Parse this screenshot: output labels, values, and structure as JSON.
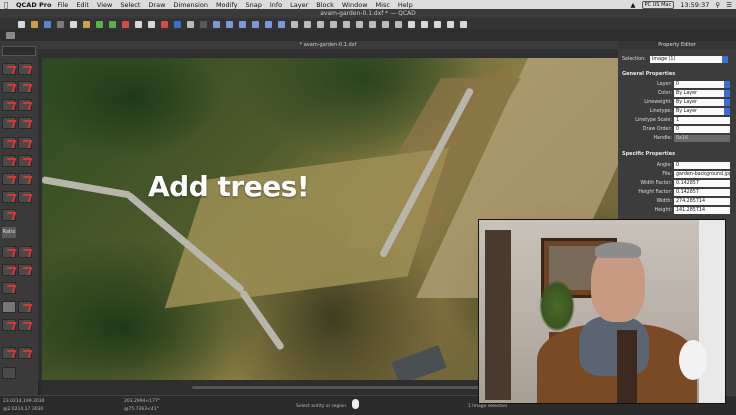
{
  "menubar": {
    "app_name": "QCAD Pro",
    "items": [
      "File",
      "Edit",
      "View",
      "Select",
      "Draw",
      "Dimension",
      "Modify",
      "Snap",
      "Info",
      "Layer",
      "Block",
      "Window",
      "Misc",
      "Help"
    ],
    "keyboard_badge": "PC US Mac",
    "clock": "13:59:37"
  },
  "window": {
    "title": "avam-garden-0.1.dxf * — QCAD",
    "doc_tab": "* avam-garden-0.1.dxf"
  },
  "tool_panel": {
    "tool_label": "Ratio"
  },
  "canvas": {
    "overlay_text": "Add trees!"
  },
  "property_editor": {
    "title": "Property Editor",
    "selection_label": "Selection:",
    "selection_value": "Image (1)",
    "general_heading": "General Properties",
    "specific_heading": "Specific Properties",
    "general": [
      {
        "label": "Layer:",
        "value": "0",
        "dropdown": true
      },
      {
        "label": "Color:",
        "value": "By Layer",
        "dropdown": true
      },
      {
        "label": "Lineweight:",
        "value": "By Layer",
        "dropdown": true
      },
      {
        "label": "Linetype:",
        "value": "By Layer",
        "dropdown": true
      },
      {
        "label": "Linetype Scale:",
        "value": "1",
        "dropdown": false
      },
      {
        "label": "Draw Order:",
        "value": "0",
        "dropdown": false
      },
      {
        "label": "Handle:",
        "value": "0x16",
        "dropdown": false
      }
    ],
    "specific": [
      {
        "label": "Angle:",
        "value": "0"
      },
      {
        "label": "File:",
        "value": "garden-background.jpg"
      },
      {
        "label": "Width Factor:",
        "value": "0.142857"
      },
      {
        "label": "Height Factor:",
        "value": "0.142857"
      },
      {
        "label": "Width:",
        "value": "274.285714"
      },
      {
        "label": "Height:",
        "value": "141.285714"
      }
    ]
  },
  "statusbar": {
    "coord_abs": "23.0214,199.3030",
    "coord_rel": "@2.0214,17.3030",
    "coord_polar_abs": "203.2994<177°",
    "coord_polar_rel": "@75.7363<41°",
    "prompt": "Select entity or region",
    "selection_count": "1 Image selected"
  },
  "colors": {
    "accent": "#3a70d6",
    "overlay_text": "#ffffff"
  }
}
